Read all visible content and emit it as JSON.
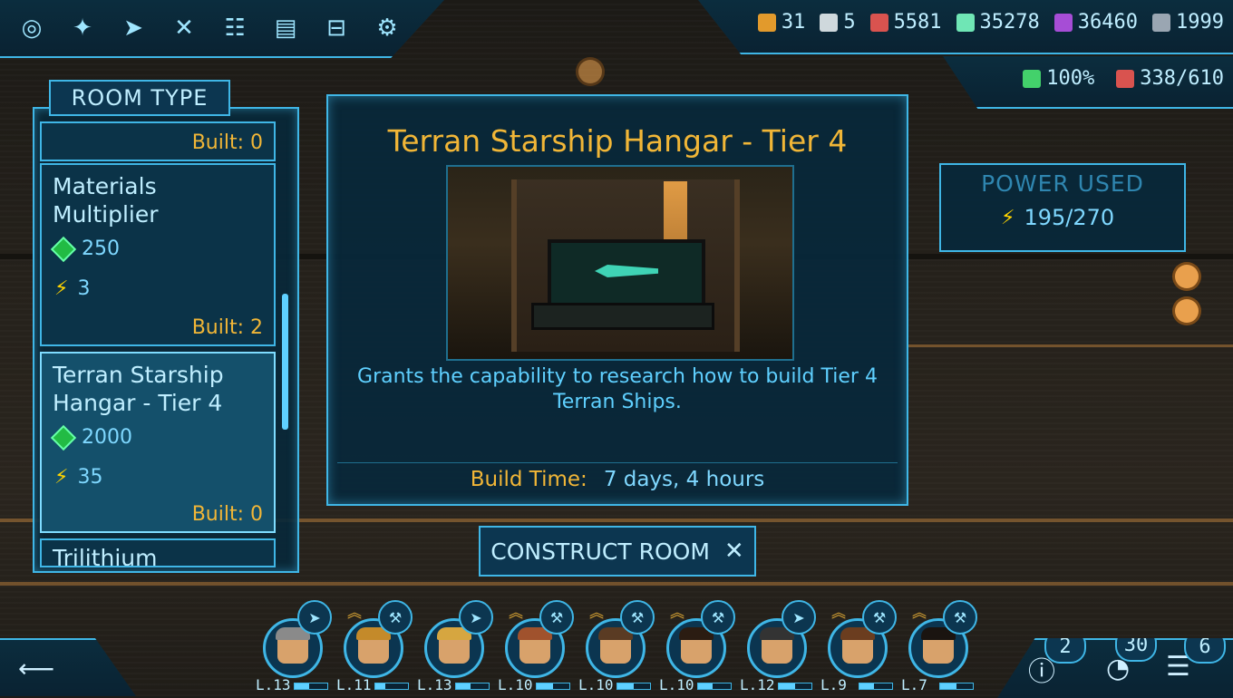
{
  "top_nav": {
    "icons": [
      "galaxy-icon",
      "ship-icon",
      "jet-icon",
      "build-tools-icon",
      "tree-icon",
      "crew-card-icon",
      "storage-icon",
      "gear-icon"
    ]
  },
  "resources": [
    {
      "name": "supply-crate",
      "value": "31",
      "color": "#e29a2c"
    },
    {
      "name": "starbux",
      "value": "5",
      "color": "#cfd8dc"
    },
    {
      "name": "crew-members",
      "value": "5581",
      "color": "#d9534f"
    },
    {
      "name": "minerals",
      "value": "35278",
      "color": "#6fe6b5"
    },
    {
      "name": "gas",
      "value": "36460",
      "color": "#a64dd6"
    },
    {
      "name": "droplet",
      "value": "1999",
      "color": "#9aa6b2"
    }
  ],
  "status": [
    {
      "name": "efficiency",
      "value": "100%",
      "color": "#43d16b"
    },
    {
      "name": "crew-capacity",
      "value": "338/610",
      "color": "#d9534f"
    }
  ],
  "room_type": {
    "tab_label": "ROOM TYPE",
    "rooms": [
      {
        "name": "",
        "cost": "",
        "power": "",
        "built": "Built: 0"
      },
      {
        "name": "Materials\nMultiplier",
        "cost": "250",
        "power": "3",
        "built": "Built: 2"
      },
      {
        "name": "Terran Starship\nHangar - Tier 4",
        "cost": "2000",
        "power": "35",
        "built": "Built: 0",
        "selected": true
      },
      {
        "name": "Trilithium",
        "cost": "",
        "power": "",
        "built": ""
      }
    ]
  },
  "detail": {
    "title": "Terran Starship Hangar - Tier 4",
    "description": "Grants the capability to research how to build Tier 4 Terran Ships.",
    "build_time_label": "Build Time:",
    "build_time_value": "7 days, 4 hours"
  },
  "construct_button": {
    "label": "CONSTRUCT ROOM"
  },
  "power": {
    "label": "POWER USED",
    "value": "195/270"
  },
  "crew": [
    {
      "level": "L.13",
      "role": "pilot",
      "promotable": false,
      "hair": "#8a8a8a",
      "progress": 0.45
    },
    {
      "level": "L.11",
      "role": "engineer",
      "promotable": true,
      "hair": "#c48a2a",
      "progress": 0.3
    },
    {
      "level": "L.13",
      "role": "pilot",
      "promotable": false,
      "hair": "#d6a640",
      "progress": 0.45
    },
    {
      "level": "L.10",
      "role": "engineer",
      "promotable": true,
      "hair": "#a0522d",
      "progress": 0.5
    },
    {
      "level": "L.10",
      "role": "engineer",
      "promotable": true,
      "hair": "#5a3b23",
      "progress": 0.5
    },
    {
      "level": "L.10",
      "role": "engineer",
      "promotable": true,
      "hair": "#2b1c12",
      "progress": 0.45
    },
    {
      "level": "L.12",
      "role": "pilot",
      "promotable": false,
      "hair": "#333333",
      "progress": 0.5
    },
    {
      "level": "L.9",
      "role": "engineer",
      "promotable": true,
      "hair": "#6b3d1f",
      "progress": 0.45
    },
    {
      "level": "L.7",
      "role": "engineer",
      "promotable": true,
      "hair": "#1a1410",
      "progress": 0.5
    }
  ],
  "bottom_right": {
    "alerts_count": "2",
    "research_count": "30",
    "menu_count": "6"
  }
}
